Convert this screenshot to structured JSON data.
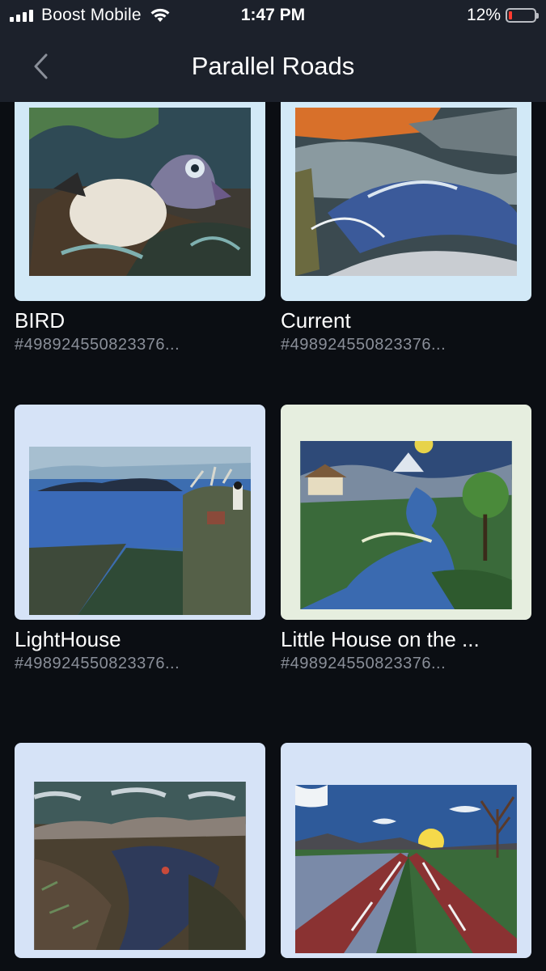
{
  "status_bar": {
    "carrier": "Boost Mobile",
    "time": "1:47 PM",
    "battery_percent": "12%",
    "battery_level": 0.12,
    "battery_color": "#ff3b30"
  },
  "nav": {
    "title": "Parallel Roads",
    "back_icon": "chevron-left-icon"
  },
  "items": [
    {
      "title": "BIRD",
      "subtitle": "#498924550823376...",
      "frame_color": "#d2e9f7"
    },
    {
      "title": "Current",
      "subtitle": "#498924550823376...",
      "frame_color": "#d2e9f7"
    },
    {
      "title": "LightHouse",
      "subtitle": "#498924550823376...",
      "frame_color": "#d6e3f7"
    },
    {
      "title": "Little House on the ...",
      "subtitle": "#498924550823376...",
      "frame_color": "#e6eedf"
    },
    {
      "title": "",
      "subtitle": "",
      "frame_color": "#d6e3f7"
    },
    {
      "title": "",
      "subtitle": "",
      "frame_color": "#d6e3f7"
    }
  ]
}
